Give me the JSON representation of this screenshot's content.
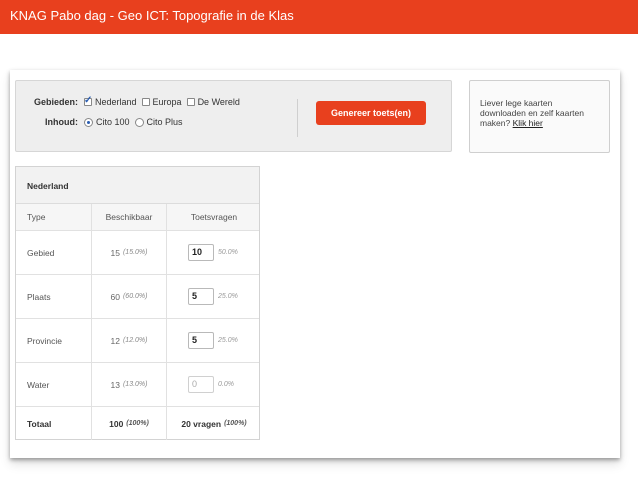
{
  "header": {
    "title": "KNAG Pabo dag - Geo ICT: Topografie in de Klas"
  },
  "filter": {
    "gebieden_label": "Gebieden:",
    "gebieden_options": [
      {
        "label": "Nederland",
        "checked": true
      },
      {
        "label": "Europa",
        "checked": false
      },
      {
        "label": "De Wereld",
        "checked": false
      }
    ],
    "inhoud_label": "Inhoud:",
    "inhoud_options": [
      {
        "label": "Cito 100",
        "selected": true
      },
      {
        "label": "Cito Plus",
        "selected": false
      }
    ],
    "generate_button": "Genereer toets(en)"
  },
  "sidebar": {
    "line1": "Liever lege kaarten",
    "line2": "downloaden en zelf kaarten",
    "line3_prefix": "maken?",
    "link": "Klik hier"
  },
  "table": {
    "title": "Nederland",
    "headers": [
      "Type",
      "Beschikbaar",
      "Toetsvragen"
    ],
    "rows": [
      {
        "type": "Gebied",
        "available": "15",
        "available_pct": "(15.0%)",
        "questions": "10",
        "questions_pct": "50.0%",
        "disabled": false
      },
      {
        "type": "Plaats",
        "available": "60",
        "available_pct": "(60.0%)",
        "questions": "5",
        "questions_pct": "25.0%",
        "disabled": false
      },
      {
        "type": "Provincie",
        "available": "12",
        "available_pct": "(12.0%)",
        "questions": "5",
        "questions_pct": "25.0%",
        "disabled": false
      },
      {
        "type": "Water",
        "available": "13",
        "available_pct": "(13.0%)",
        "questions": "0",
        "questions_pct": "0.0%",
        "disabled": true
      }
    ],
    "total": {
      "label": "Totaal",
      "available": "100",
      "available_pct": "(100%)",
      "questions": "20 vragen",
      "questions_pct": "(100%)"
    }
  },
  "colors": {
    "accent": "#e8401e",
    "check": "#2a5db0"
  }
}
